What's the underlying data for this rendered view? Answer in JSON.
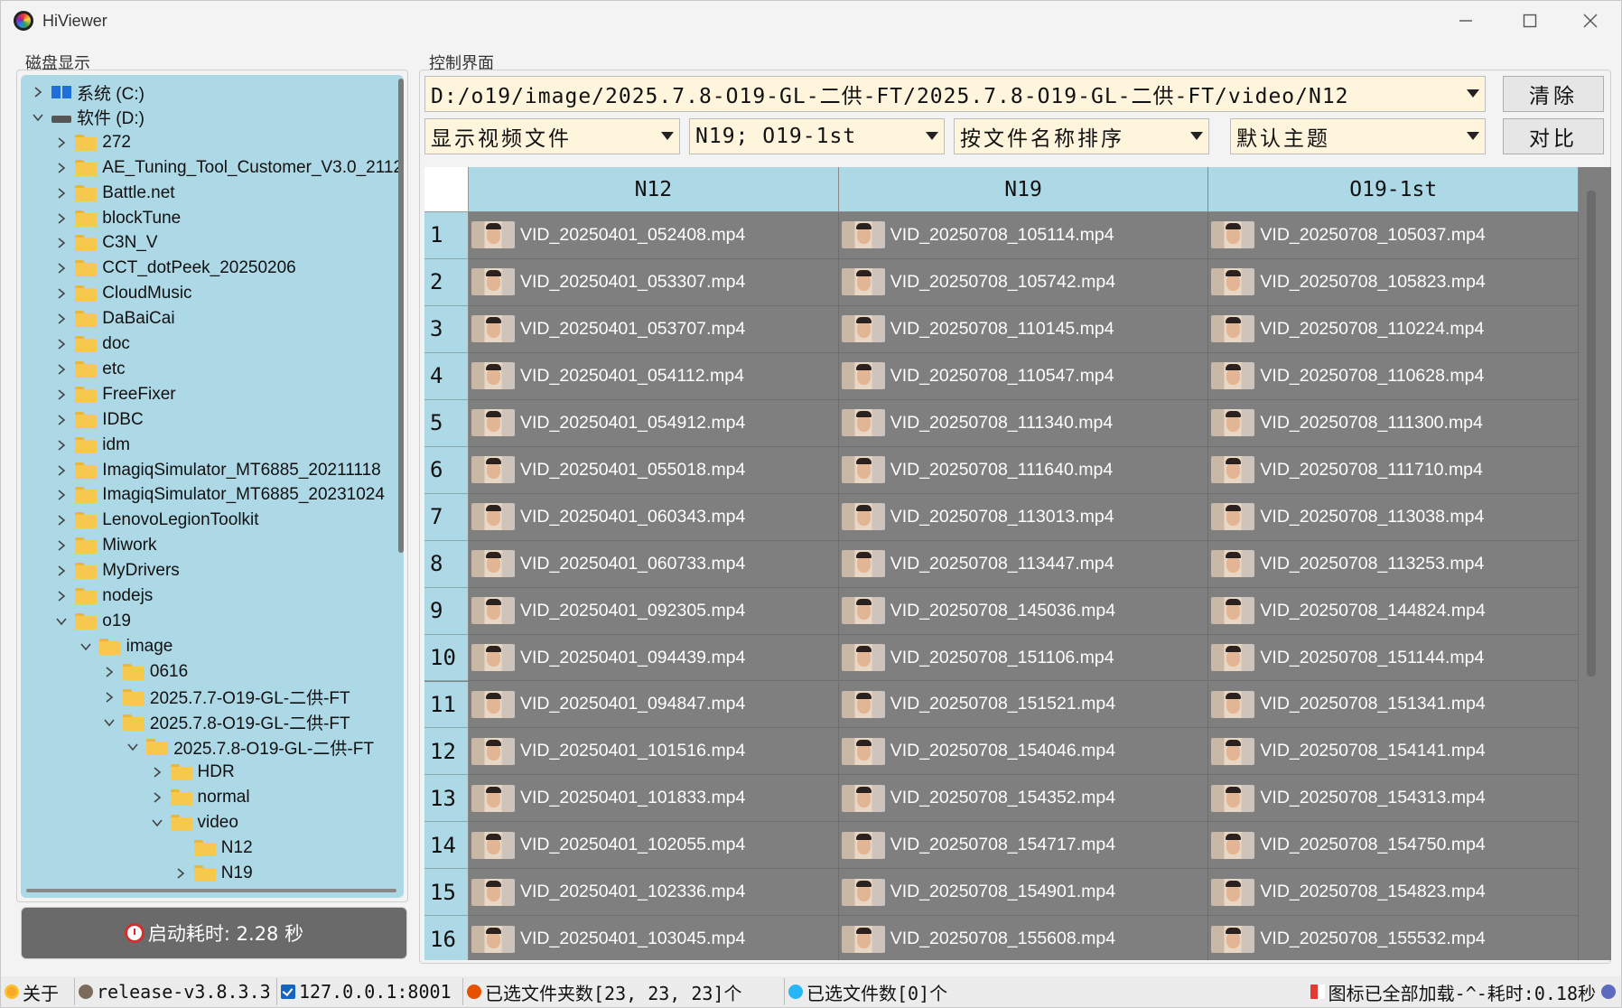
{
  "window": {
    "title": "HiViewer"
  },
  "left_panel": {
    "group_label": "磁盘显示",
    "tree": [
      {
        "label": "系统 (C:)",
        "level": 0,
        "expanded": false,
        "kind": "drive-c"
      },
      {
        "label": "软件 (D:)",
        "level": 0,
        "expanded": true,
        "kind": "drive-d"
      },
      {
        "label": "272",
        "level": 1,
        "expanded": false,
        "kind": "folder"
      },
      {
        "label": "AE_Tuning_Tool_Customer_V3.0_2112",
        "level": 1,
        "expanded": false,
        "kind": "folder"
      },
      {
        "label": "Battle.net",
        "level": 1,
        "expanded": false,
        "kind": "folder"
      },
      {
        "label": "blockTune",
        "level": 1,
        "expanded": false,
        "kind": "folder"
      },
      {
        "label": "C3N_V",
        "level": 1,
        "expanded": false,
        "kind": "folder"
      },
      {
        "label": "CCT_dotPeek_20250206",
        "level": 1,
        "expanded": false,
        "kind": "folder"
      },
      {
        "label": "CloudMusic",
        "level": 1,
        "expanded": false,
        "kind": "folder"
      },
      {
        "label": "DaBaiCai",
        "level": 1,
        "expanded": false,
        "kind": "folder"
      },
      {
        "label": "doc",
        "level": 1,
        "expanded": false,
        "kind": "folder"
      },
      {
        "label": "etc",
        "level": 1,
        "expanded": false,
        "kind": "folder"
      },
      {
        "label": "FreeFixer",
        "level": 1,
        "expanded": false,
        "kind": "folder"
      },
      {
        "label": "IDBC",
        "level": 1,
        "expanded": false,
        "kind": "folder"
      },
      {
        "label": "idm",
        "level": 1,
        "expanded": false,
        "kind": "folder"
      },
      {
        "label": "ImagiqSimulator_MT6885_20211118",
        "level": 1,
        "expanded": false,
        "kind": "folder"
      },
      {
        "label": "ImagiqSimulator_MT6885_20231024",
        "level": 1,
        "expanded": false,
        "kind": "folder"
      },
      {
        "label": "LenovoLegionToolkit",
        "level": 1,
        "expanded": false,
        "kind": "folder"
      },
      {
        "label": "Miwork",
        "level": 1,
        "expanded": false,
        "kind": "folder"
      },
      {
        "label": "MyDrivers",
        "level": 1,
        "expanded": false,
        "kind": "folder"
      },
      {
        "label": "nodejs",
        "level": 1,
        "expanded": false,
        "kind": "folder"
      },
      {
        "label": "o19",
        "level": 1,
        "expanded": true,
        "kind": "folder"
      },
      {
        "label": "image",
        "level": 2,
        "expanded": true,
        "kind": "folder"
      },
      {
        "label": "0616",
        "level": 3,
        "expanded": false,
        "kind": "folder"
      },
      {
        "label": "2025.7.7-O19-GL-二供-FT",
        "level": 3,
        "expanded": false,
        "kind": "folder"
      },
      {
        "label": "2025.7.8-O19-GL-二供-FT",
        "level": 3,
        "expanded": true,
        "kind": "folder"
      },
      {
        "label": "2025.7.8-O19-GL-二供-FT",
        "level": 4,
        "expanded": true,
        "kind": "folder"
      },
      {
        "label": "HDR",
        "level": 5,
        "expanded": false,
        "kind": "folder"
      },
      {
        "label": "normal",
        "level": 5,
        "expanded": false,
        "kind": "folder"
      },
      {
        "label": "video",
        "level": 5,
        "expanded": true,
        "kind": "folder"
      },
      {
        "label": "N12",
        "level": 6,
        "expanded": null,
        "kind": "folder",
        "selected": true
      },
      {
        "label": "N19",
        "level": 6,
        "expanded": false,
        "kind": "folder"
      }
    ],
    "startup_text": "启动耗时: 2.28 秒"
  },
  "control": {
    "group_label": "控制界面",
    "path": "D:/o19/image/2025.7.8-O19-GL-二供-FT/2025.7.8-O19-GL-二供-FT/video/N12",
    "clear_label": "清除",
    "compare_label": "对比",
    "filter_value": "显示视频文件",
    "folders_value": "N19; O19-1st",
    "sort_value": "按文件名称排序",
    "theme_value": "默认主题"
  },
  "table": {
    "columns": [
      "N12",
      "N19",
      "O19-1st"
    ],
    "rows": [
      [
        "VID_20250401_052408.mp4",
        "VID_20250708_105114.mp4",
        "VID_20250708_105037.mp4"
      ],
      [
        "VID_20250401_053307.mp4",
        "VID_20250708_105742.mp4",
        "VID_20250708_105823.mp4"
      ],
      [
        "VID_20250401_053707.mp4",
        "VID_20250708_110145.mp4",
        "VID_20250708_110224.mp4"
      ],
      [
        "VID_20250401_054112.mp4",
        "VID_20250708_110547.mp4",
        "VID_20250708_110628.mp4"
      ],
      [
        "VID_20250401_054912.mp4",
        "VID_20250708_111340.mp4",
        "VID_20250708_111300.mp4"
      ],
      [
        "VID_20250401_055018.mp4",
        "VID_20250708_111640.mp4",
        "VID_20250708_111710.mp4"
      ],
      [
        "VID_20250401_060343.mp4",
        "VID_20250708_113013.mp4",
        "VID_20250708_113038.mp4"
      ],
      [
        "VID_20250401_060733.mp4",
        "VID_20250708_113447.mp4",
        "VID_20250708_113253.mp4"
      ],
      [
        "VID_20250401_092305.mp4",
        "VID_20250708_145036.mp4",
        "VID_20250708_144824.mp4"
      ],
      [
        "VID_20250401_094439.mp4",
        "VID_20250708_151106.mp4",
        "VID_20250708_151144.mp4"
      ],
      [
        "VID_20250401_094847.mp4",
        "VID_20250708_151521.mp4",
        "VID_20250708_151341.mp4"
      ],
      [
        "VID_20250401_101516.mp4",
        "VID_20250708_154046.mp4",
        "VID_20250708_154141.mp4"
      ],
      [
        "VID_20250401_101833.mp4",
        "VID_20250708_154352.mp4",
        "VID_20250708_154313.mp4"
      ],
      [
        "VID_20250401_102055.mp4",
        "VID_20250708_154717.mp4",
        "VID_20250708_154750.mp4"
      ],
      [
        "VID_20250401_102336.mp4",
        "VID_20250708_154901.mp4",
        "VID_20250708_154823.mp4"
      ],
      [
        "VID_20250401_103045.mp4",
        "VID_20250708_155608.mp4",
        "VID_20250708_155532.mp4"
      ]
    ]
  },
  "statusbar": {
    "about": "关于",
    "version": "release-v3.8.3.3",
    "address": "127.0.0.1:8001",
    "selected_folders": "已选文件夹数[23, 23, 23]个",
    "selected_files": "已选文件数[0]个",
    "icons_status": "图标已全部加载-^-耗时:0.18秒"
  },
  "colors": {
    "tree_bg": "#add8e6",
    "table_bg": "#7f7f7f",
    "combo_bg": "#fff5dc",
    "header_bg": "#add8e6"
  }
}
